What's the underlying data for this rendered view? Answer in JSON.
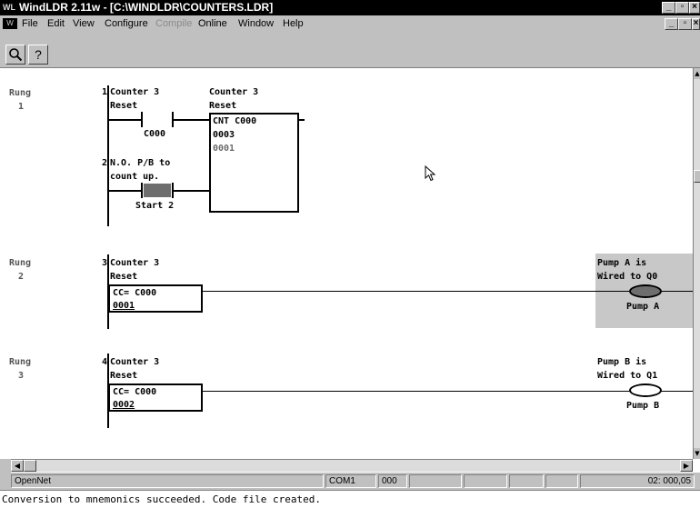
{
  "window": {
    "title": "WindLDR 2.11w - [C:\\WINDLDR\\COUNTERS.LDR]",
    "app_icon": "windldr-app-icon",
    "controls": [
      "minimize-icon",
      "restore-icon",
      "close-icon"
    ]
  },
  "menu": {
    "doc_icon": "ldr-document-icon",
    "items": [
      {
        "label": "File",
        "enabled": true
      },
      {
        "label": "Edit",
        "enabled": true
      },
      {
        "label": "View",
        "enabled": true
      },
      {
        "label": "Configure",
        "enabled": true
      },
      {
        "label": "Compile",
        "enabled": false
      },
      {
        "label": "Online",
        "enabled": true
      },
      {
        "label": "Window",
        "enabled": true
      },
      {
        "label": "Help",
        "enabled": true
      }
    ]
  },
  "toolbar": {
    "zoom_icon": "magnifier-icon",
    "help_glyph": "?"
  },
  "ladder": {
    "rung_label": "Rung",
    "rung1": {
      "num": "1",
      "line1_num": "1",
      "line1_comment_a": "Counter 3",
      "line1_comment_b": "Reset",
      "contact_c000": "C000",
      "counter_comment_a": "Counter 3",
      "counter_comment_b": "Reset",
      "counter_instr": "CNT C000",
      "counter_preset": "0003",
      "counter_current": "0001",
      "line2_num": "2",
      "line2_comment_a": "N.O. P/B to",
      "line2_comment_b": "count up.",
      "contact_start": "Start 2"
    },
    "rung2": {
      "num": "2",
      "line_num": "3",
      "comment_a": "Counter 3",
      "comment_b": "Reset",
      "compare_instr": "CC= C000",
      "compare_value": "0001",
      "coil_comment_a": "Pump A is",
      "coil_comment_b": "Wired to Q0",
      "coil_label": "Pump A",
      "coil_state": "on"
    },
    "rung3": {
      "num": "3",
      "line_num": "4",
      "comment_a": "Counter 3",
      "comment_b": "Reset",
      "compare_instr": "CC= C000",
      "compare_value": "0002",
      "coil_comment_a": "Pump B is",
      "coil_comment_b": "Wired to Q1",
      "coil_label": "Pump B",
      "coil_state": "off"
    }
  },
  "status": {
    "mode": "OpenNet",
    "port": "COM1",
    "station": "000",
    "position": "02: 000,05"
  },
  "message": "Conversion to mnemonics succeeded. Code file created.",
  "colors": {
    "titlebar": "#000000",
    "chrome": "#c0c0c0",
    "coil_on_highlight": "#c8c8c8",
    "coil_on_fill": "#6e6e6e"
  }
}
